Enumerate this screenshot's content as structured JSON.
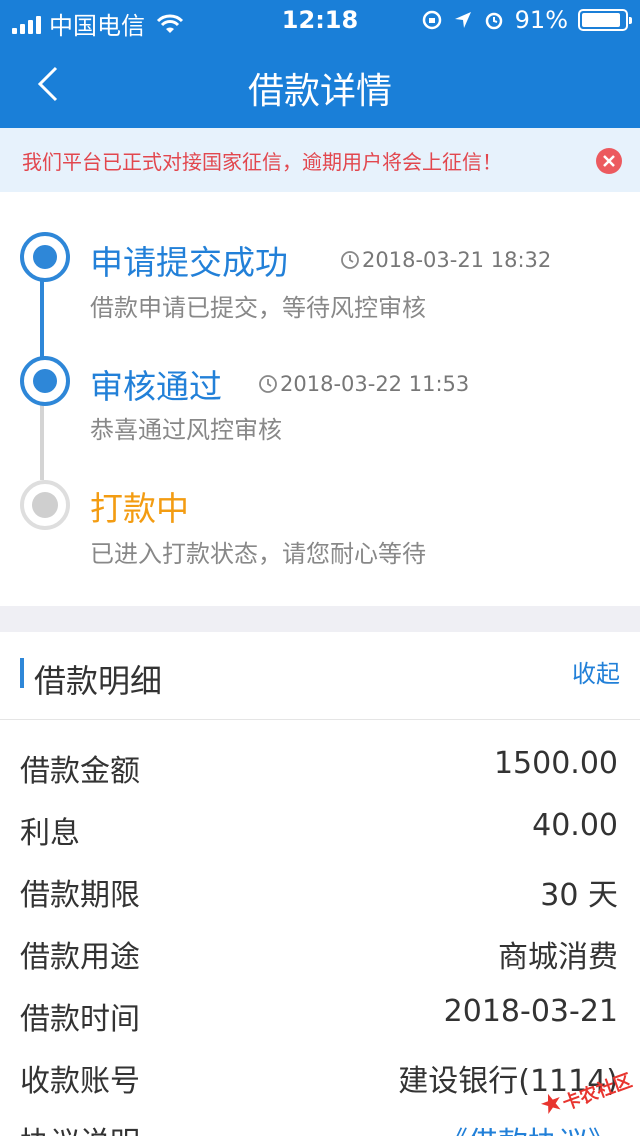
{
  "status_bar": {
    "carrier": "中国电信",
    "time": "12:18",
    "battery_percent": "91%",
    "battery_level": 0.91
  },
  "nav": {
    "title": "借款详情"
  },
  "notice": {
    "text": "我们平台已正式对接国家征信，逾期用户将会上征信！"
  },
  "timeline": {
    "steps": [
      {
        "title": "申请提交成功",
        "time": "2018-03-21 18:32",
        "desc": "借款申请已提交，等待风控审核",
        "status": "done"
      },
      {
        "title": "审核通过",
        "time": "2018-03-22 11:53",
        "desc": "恭喜通过风控审核",
        "status": "done"
      },
      {
        "title": "打款中",
        "time": "",
        "desc": "已进入打款状态，请您耐心等待",
        "status": "pending"
      }
    ]
  },
  "detail": {
    "title": "借款明细",
    "collapse_label": "收起",
    "rows": [
      {
        "label": "借款金额",
        "value": "1500.00"
      },
      {
        "label": "利息",
        "value": "40.00"
      },
      {
        "label": "借款期限",
        "value": "30 天"
      },
      {
        "label": "借款用途",
        "value": "商城消费"
      },
      {
        "label": "借款时间",
        "value": "2018-03-21"
      },
      {
        "label": "收款账号",
        "value": "建设银行(1114)"
      },
      {
        "label": "协议说明",
        "value": "《借款协议》"
      }
    ]
  },
  "watermark": {
    "text": "卡农社区"
  },
  "colors": {
    "primary": "#1a7fd8",
    "accent_blue": "#2280d8",
    "warning_red": "#e2474e",
    "pending_orange": "#f39c12"
  }
}
